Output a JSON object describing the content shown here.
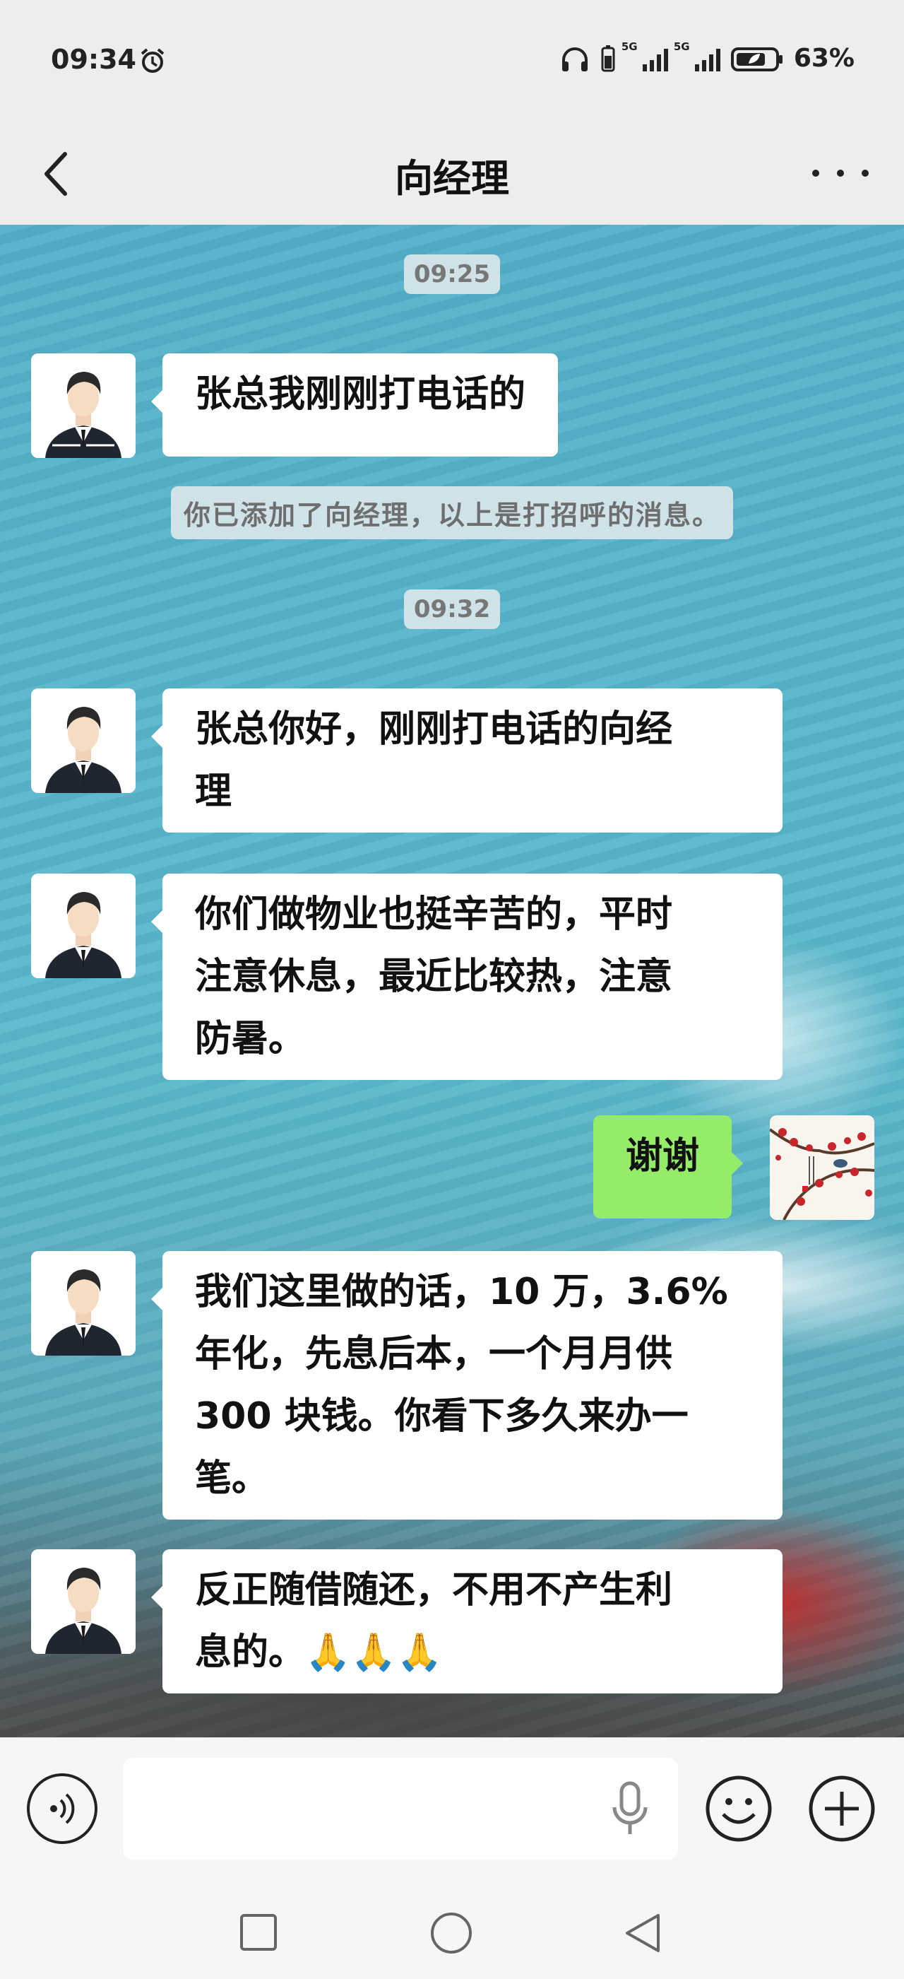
{
  "status_bar": {
    "time": "09:34",
    "battery": "63%",
    "network_1": "5G",
    "network_2": "5G",
    "icons": [
      "alarm-icon",
      "headphones-icon",
      "battery-small-icon",
      "signal-icon",
      "signal-icon",
      "battery-saver-icon"
    ]
  },
  "header": {
    "title": "向经理",
    "back_icon": "chevron-left-icon",
    "more_icon": "more-dots-icon"
  },
  "chat": {
    "timestamp_1": "09:25",
    "msg_1": "张总我刚刚打电话的",
    "system_note": "你已添加了向经理，以上是打招呼的消息。",
    "timestamp_2": "09:32",
    "msg_2_line1": "张总你好，刚刚打电话的向经",
    "msg_2_line2": "理",
    "msg_3_line1": "你们做物业也挺辛苦的，平时",
    "msg_3_line2": "注意休息，最近比较热，注意",
    "msg_3_line3": "防暑。",
    "msg_4": "谢谢",
    "msg_5_line1": "我们这里做的话，10 万，3.6%",
    "msg_5_line2": "年化，先息后本，一个月月供",
    "msg_5_line3": "300 块钱。你看下多久来办一",
    "msg_5_line4": "笔。",
    "msg_6_line1": "反正随借随还，不用不产生利",
    "msg_6_line2": "息的。",
    "msg_6_emoji": "🙏🙏🙏"
  },
  "input_bar": {
    "voice_icon": "voice-input-icon",
    "mic_icon": "microphone-icon",
    "emoji_icon": "emoji-smile-icon",
    "plus_icon": "plus-circle-icon"
  },
  "nav_bar": {
    "icons": [
      "recent-apps-icon",
      "home-icon",
      "back-triangle-icon"
    ]
  },
  "colors": {
    "bubble_in": "#ffffff",
    "bubble_out": "#95ec69",
    "chat_bg": "#52b0c8",
    "bar_bg": "#ededed"
  }
}
